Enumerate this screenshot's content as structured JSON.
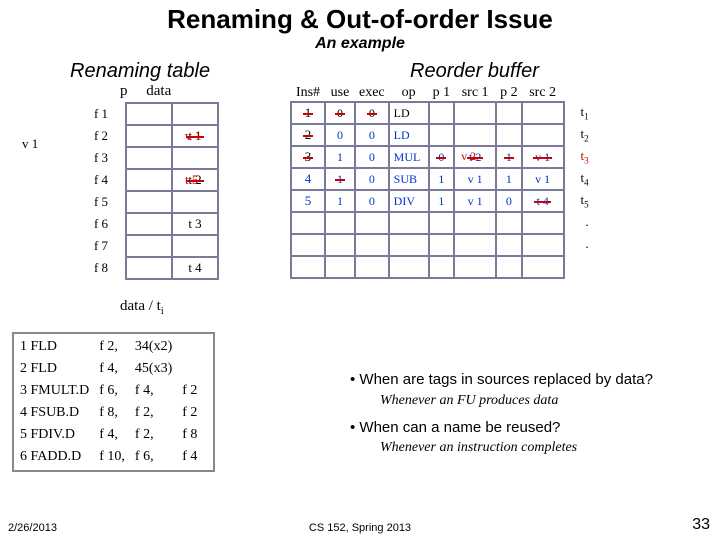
{
  "title": "Renaming & Out-of-order Issue",
  "subtitle": "An example",
  "renaming": {
    "title": "Renaming table",
    "hdr_p": "p",
    "hdr_data": "data",
    "v1_label": "v 1",
    "rows": [
      {
        "reg": "f 1",
        "data": ""
      },
      {
        "reg": "f 2",
        "data_struck": "t 1",
        "data_new": "v 1"
      },
      {
        "reg": "f 3",
        "data": ""
      },
      {
        "reg": "f 4",
        "data_struck": "t 2",
        "data_new": "t 5"
      },
      {
        "reg": "f 5",
        "data": ""
      },
      {
        "reg": "f 6",
        "data": "t 3"
      },
      {
        "reg": "f 7",
        "data": ""
      },
      {
        "reg": "f 8",
        "data": "t 4"
      }
    ],
    "datati": "data / t"
  },
  "rob": {
    "title": "Reorder buffer",
    "headers": [
      "Ins#",
      "use",
      "exec",
      "op",
      "p 1",
      "src 1",
      "p 2",
      "src 2"
    ],
    "rows": [
      {
        "ins": "1",
        "ins_struck": true,
        "use": "0",
        "use_struck": true,
        "exec": "0",
        "exec_struck": true,
        "op": "LD",
        "p1": "",
        "src1": "",
        "p2": "",
        "src2": "",
        "tag": "t",
        "tagn": "1"
      },
      {
        "ins": "2",
        "ins_struck": true,
        "use": "0",
        "exec": "0",
        "op": "LD",
        "p1": "",
        "src1": "",
        "p2": "",
        "src2": "",
        "tag": "t",
        "tagn": "2"
      },
      {
        "ins": "3",
        "ins_struck": true,
        "use": "1",
        "exec": "0",
        "op": "MUL",
        "p1": "0",
        "p1_struck": true,
        "src1": "t 2",
        "src1_struck": true,
        "src1_new": "v 2",
        "p2": "1",
        "p2_struck": true,
        "src2": "v 1",
        "src2_struck": true,
        "tag": "t",
        "tagn": "3",
        "tag_red": true
      },
      {
        "ins": "4",
        "use": "1",
        "use_struck": true,
        "exec": "0",
        "op": "SUB",
        "p1": "1",
        "src1": "v 1",
        "p2": "1",
        "src2": "v 1",
        "tag": "t",
        "tagn": "4"
      },
      {
        "ins": "5",
        "use": "1",
        "exec": "0",
        "op": "DIV",
        "p1": "1",
        "src1": "v 1",
        "p2": "0",
        "src2": "t 4",
        "src2_struck": true,
        "tag": "t",
        "tagn": "5"
      },
      {
        "ins": "",
        "use": "",
        "exec": "",
        "op": "",
        "p1": "",
        "src1": "",
        "p2": "",
        "src2": "",
        "tag": ".",
        "tagn": ""
      },
      {
        "ins": "",
        "use": "",
        "exec": "",
        "op": "",
        "p1": "",
        "src1": "",
        "p2": "",
        "src2": "",
        "tag": ".",
        "tagn": ""
      },
      {
        "ins": "",
        "use": "",
        "exec": "",
        "op": "",
        "p1": "",
        "src1": "",
        "p2": "",
        "src2": ""
      }
    ]
  },
  "ilist": {
    "rows": [
      {
        "n": "1",
        "op": "FLD",
        "rd": "f 2,",
        "a": "34(x2)",
        "rs": ""
      },
      {
        "n": "2",
        "op": "FLD",
        "rd": "f 4,",
        "a": "45(x3)",
        "rs": ""
      },
      {
        "n": "3",
        "op": "FMULT.D",
        "rd": "f 6,",
        "a": "f 4,",
        "rs": "f 2"
      },
      {
        "n": "4",
        "op": "FSUB.D",
        "rd": "f 8,",
        "a": "f 2,",
        "rs": "f 2"
      },
      {
        "n": "5",
        "op": "FDIV.D",
        "rd": "f 4,",
        "a": "f 2,",
        "rs": "f 8"
      },
      {
        "n": "6",
        "op": "FADD.D",
        "rd": "f 10,",
        "a": "f 6,",
        "rs": "f 4"
      }
    ]
  },
  "bullets": {
    "q1": "• When are tags in sources replaced by data?",
    "a1": "Whenever an FU produces data",
    "q2": "• When can a name be reused?",
    "a2": "Whenever an instruction completes"
  },
  "footer": {
    "date": "2/26/2013",
    "mid": "CS 152, Spring 2013",
    "page": "33"
  }
}
